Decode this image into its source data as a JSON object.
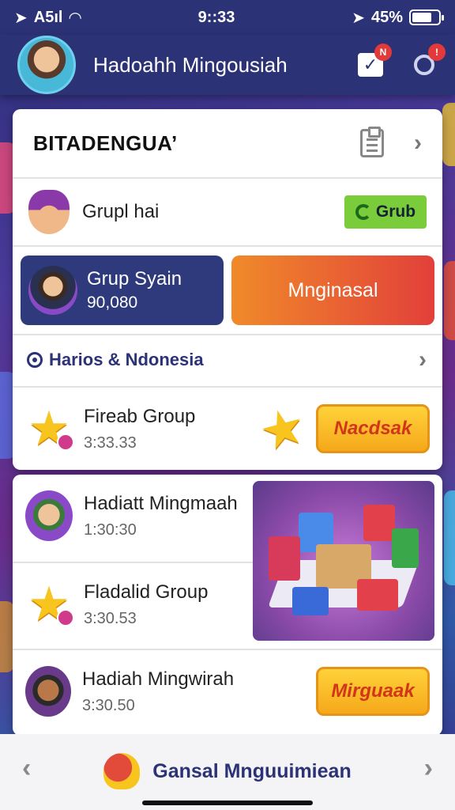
{
  "status": {
    "carrier": "A5ıl",
    "time": "9::33",
    "battery": "45%"
  },
  "header": {
    "title": "Hadoahh Mingousiah",
    "notif_badge": "N"
  },
  "card": {
    "title": "BITADENGUA’",
    "group": {
      "label": "Grupl hai",
      "button": "Grub"
    },
    "profile": {
      "name": "Grup Syain",
      "score": "90,080"
    },
    "action_button": "Mnginasal",
    "region": "Harios & Ndonesia",
    "event": {
      "title": "Fireab Group",
      "time": "3:33.33",
      "button": "Nacdsak"
    }
  },
  "card2": {
    "items": [
      {
        "title": "Hadiatt Mingmaah",
        "time": "1:30:30"
      },
      {
        "title": "Fladalid Group",
        "time": "3:30.53"
      },
      {
        "title": "Hadiah Mingwirah",
        "time": "3:30.50",
        "button": "Mirguaak"
      }
    ]
  },
  "bottom": {
    "label": "Gansal Mnguuimiean"
  },
  "colors": {
    "accent": "#2c3276",
    "green": "#7bcc3a",
    "orange": "#f08a2a",
    "yellow": "#ffd23a"
  }
}
